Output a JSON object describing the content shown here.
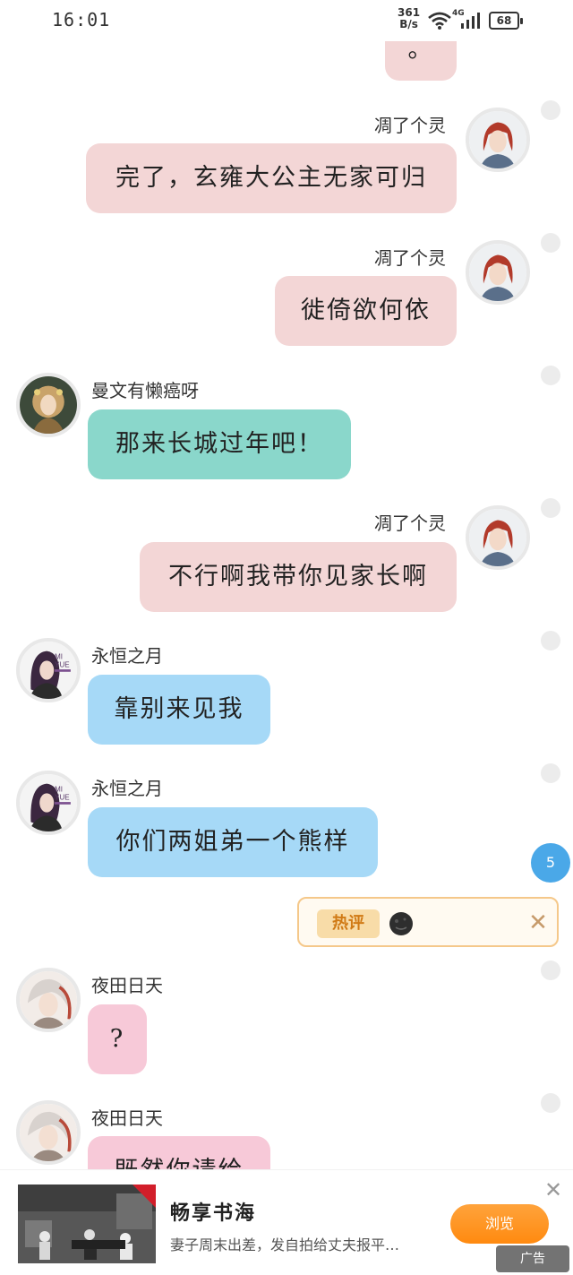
{
  "status_bar": {
    "time": "16:01",
    "net_speed_value": "361",
    "net_speed_unit": "B/s",
    "signal_label": "4G",
    "battery": "68"
  },
  "messages": [
    {
      "text": "。"
    },
    {
      "name": "凋了个灵",
      "text": "完了，玄雍大公主无家可归"
    },
    {
      "name": "凋了个灵",
      "text": "徙倚欲何依"
    },
    {
      "name": "曼文有懒癌呀",
      "text": "那来长城过年吧！"
    },
    {
      "name": "凋了个灵",
      "text": "不行啊我带你见家长啊"
    },
    {
      "name": "永恒之月",
      "text": "靠别来见我"
    },
    {
      "name": "永恒之月",
      "text": "你们两姐弟一个熊样"
    },
    {
      "name": "夜田日天",
      "text": "?"
    },
    {
      "name": "夜田日天",
      "text": "既然你请给"
    }
  ],
  "avatar_text": {
    "line1": "MI",
    "line2": "YUE"
  },
  "floating": {
    "unread_count": "5",
    "hot_label": "热评",
    "hot_close": "✕"
  },
  "ad": {
    "title": "畅享书海",
    "description": "妻子周末出差，发自拍给丈夫报平…",
    "button": "浏览",
    "close": "✕",
    "label": "广告"
  },
  "colors": {
    "self_bubble": "#f3d6d6",
    "teal_bubble": "#8ad7cb",
    "blue_bubble": "#a6d9f7",
    "rose_bubble": "#f7c9d8",
    "accent_orange": "#ff8a10",
    "badge_blue": "#4aa8e8"
  }
}
